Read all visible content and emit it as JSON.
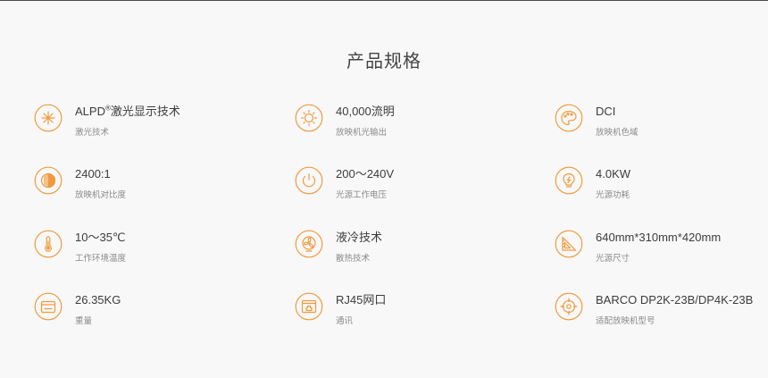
{
  "page": {
    "title": "产品规格",
    "accent_color": "#f09a3e"
  },
  "specs": [
    {
      "icon": "laser-burst-icon",
      "value_main": "ALPD",
      "value_sup": "®",
      "value_rest": "激光显示技术",
      "label": "激光技术"
    },
    {
      "icon": "sun-icon",
      "value": "40,000流明",
      "label": "放映机光输出"
    },
    {
      "icon": "palette-icon",
      "value": "DCI",
      "label": "放映机色域"
    },
    {
      "icon": "contrast-icon",
      "value": "2400:1",
      "label": "放映机对比度"
    },
    {
      "icon": "power-icon",
      "value": "200～240V",
      "label": "光源工作电压"
    },
    {
      "icon": "bulb-icon",
      "value": "4.0KW",
      "label": "光源功耗"
    },
    {
      "icon": "thermometer-icon",
      "value": "10～35℃",
      "label": "工作环境温度"
    },
    {
      "icon": "fan-icon",
      "value": "液冷技术",
      "label": "散热技术"
    },
    {
      "icon": "ruler-triangle-icon",
      "value": "640mm*310mm*420mm",
      "label": "光源尺寸"
    },
    {
      "icon": "scale-icon",
      "value": "26.35KG",
      "label": "重量"
    },
    {
      "icon": "network-port-icon",
      "value": "RJ45网口",
      "label": "通讯"
    },
    {
      "icon": "target-icon",
      "value": "BARCO DP2K-23B/DP4K-23B",
      "label": "适配放映机型号"
    }
  ]
}
